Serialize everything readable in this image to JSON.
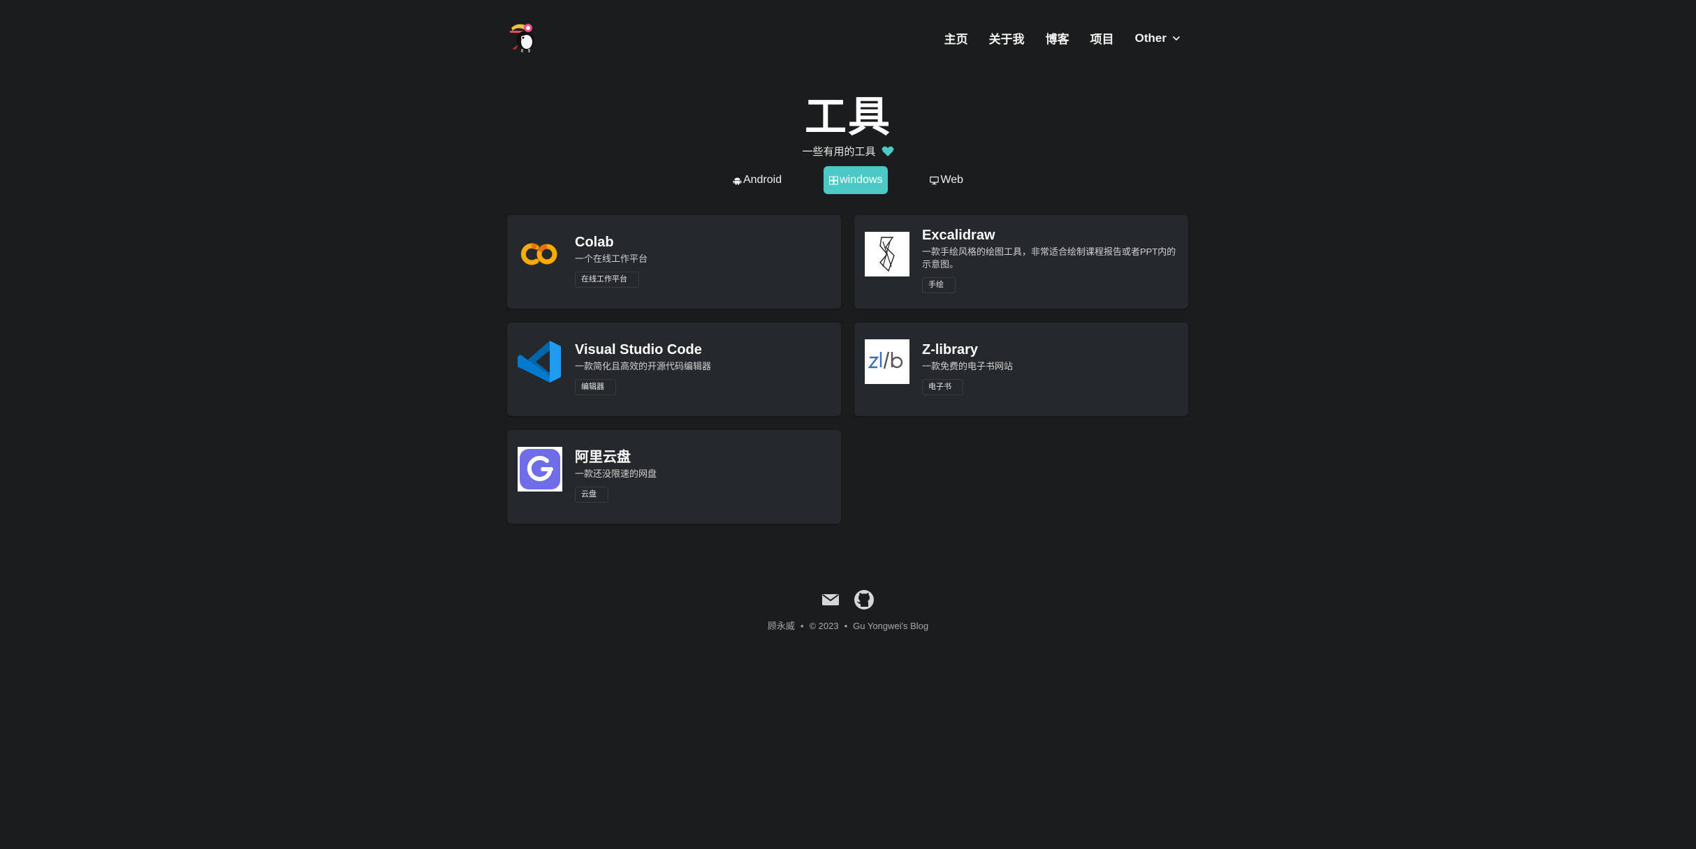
{
  "nav": {
    "home": "主页",
    "about": "关于我",
    "blog": "博客",
    "projects": "项目",
    "other": "Other"
  },
  "hero": {
    "title": "工具",
    "subtitle": "一些有用的工具"
  },
  "tabs": [
    {
      "label": "Android",
      "icon": "android-icon",
      "active": false
    },
    {
      "label": "windows",
      "icon": "windows-icon",
      "active": true
    },
    {
      "label": "Web",
      "icon": "monitor-icon",
      "active": false
    }
  ],
  "tools": [
    {
      "name": "Colab",
      "desc": "一个在线工作平台",
      "tag": "在线工作平台",
      "icon": "colab-icon"
    },
    {
      "name": "Excalidraw",
      "desc": "一款手绘风格的绘图工具，非常适合绘制课程报告或者PPT内的示意图。",
      "tag": "手绘",
      "icon": "excalidraw-icon"
    },
    {
      "name": "Visual Studio Code",
      "desc": "一款简化且高效的开源代码编辑器",
      "tag": "编辑器",
      "icon": "vscode-icon"
    },
    {
      "name": "Z-library",
      "desc": "一款免费的电子书网站",
      "tag": "电子书",
      "icon": "zlibrary-icon"
    },
    {
      "name": "阿里云盘",
      "desc": "一款还没限速的网盘",
      "tag": "云盘",
      "icon": "aliyun-drive-icon"
    }
  ],
  "footer": {
    "author": "顾永威",
    "copyright": "© 2023",
    "site": "Gu Yongwei's Blog"
  },
  "colors": {
    "background": "#1b1c1d",
    "card": "#25282c",
    "accent": "#4cc9c7"
  }
}
